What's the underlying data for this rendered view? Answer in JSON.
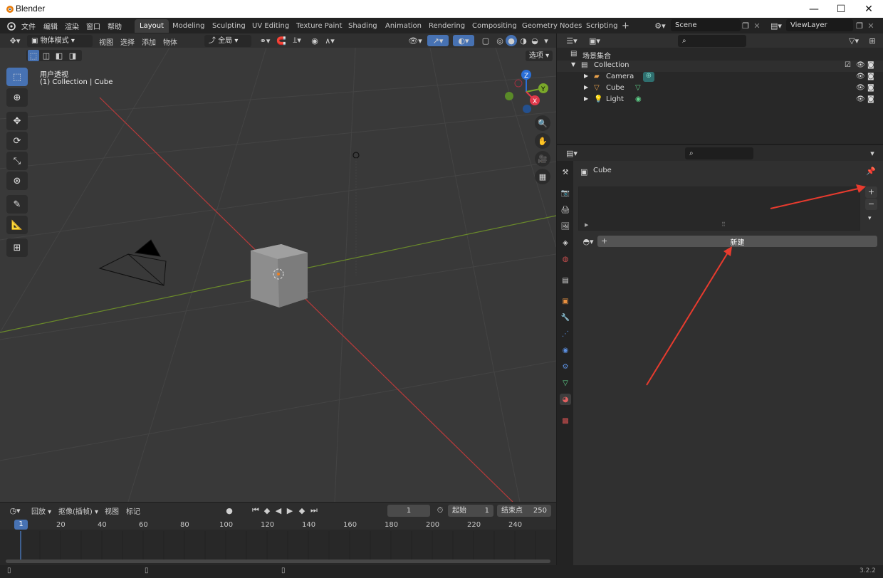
{
  "window": {
    "title": "Blender",
    "minimize": "—",
    "maximize": "☐",
    "close": "✕"
  },
  "menubar": {
    "items": [
      "文件",
      "编辑",
      "渲染",
      "窗口",
      "帮助"
    ],
    "workspaces": [
      "Layout",
      "Modeling",
      "Sculpting",
      "UV Editing",
      "Texture Paint",
      "Shading",
      "Animation",
      "Rendering",
      "Compositing",
      "Geometry Nodes",
      "Scripting"
    ],
    "active_workspace": "Layout",
    "add_workspace": "+",
    "scene": "Scene",
    "view_layer": "ViewLayer"
  },
  "viewport": {
    "mode": "物体模式",
    "menus": [
      "视图",
      "选择",
      "添加",
      "物体"
    ],
    "transform_orientation": "全局",
    "options_label": "选项",
    "overlay_title": "用户透视",
    "overlay_subtitle": "(1) Collection | Cube",
    "gizmo": {
      "z": "Z",
      "y": "Y",
      "x": "X"
    }
  },
  "outliner": {
    "root": "场景集合",
    "collection": "Collection",
    "items": [
      "Camera",
      "Cube",
      "Light"
    ]
  },
  "properties": {
    "object_name": "Cube",
    "new_button": "新建",
    "add": "+",
    "remove": "−"
  },
  "timeline": {
    "playback": "回放",
    "keying": "抠像(插帧)",
    "view": "视图",
    "marker": "标记",
    "current_frame": "1",
    "start_label": "起始",
    "start_value": "1",
    "end_label": "结束点",
    "end_value": "250",
    "ticks": [
      "20",
      "40",
      "60",
      "80",
      "100",
      "120",
      "140",
      "160",
      "180",
      "200",
      "220",
      "240"
    ],
    "current_marker": "1"
  },
  "statusbar": {
    "version": "3.2.2"
  },
  "colors": {
    "accent": "#4772b3",
    "viewport_bg": "#393939",
    "panel_bg": "#303030",
    "annotation": "#e83b2e"
  }
}
